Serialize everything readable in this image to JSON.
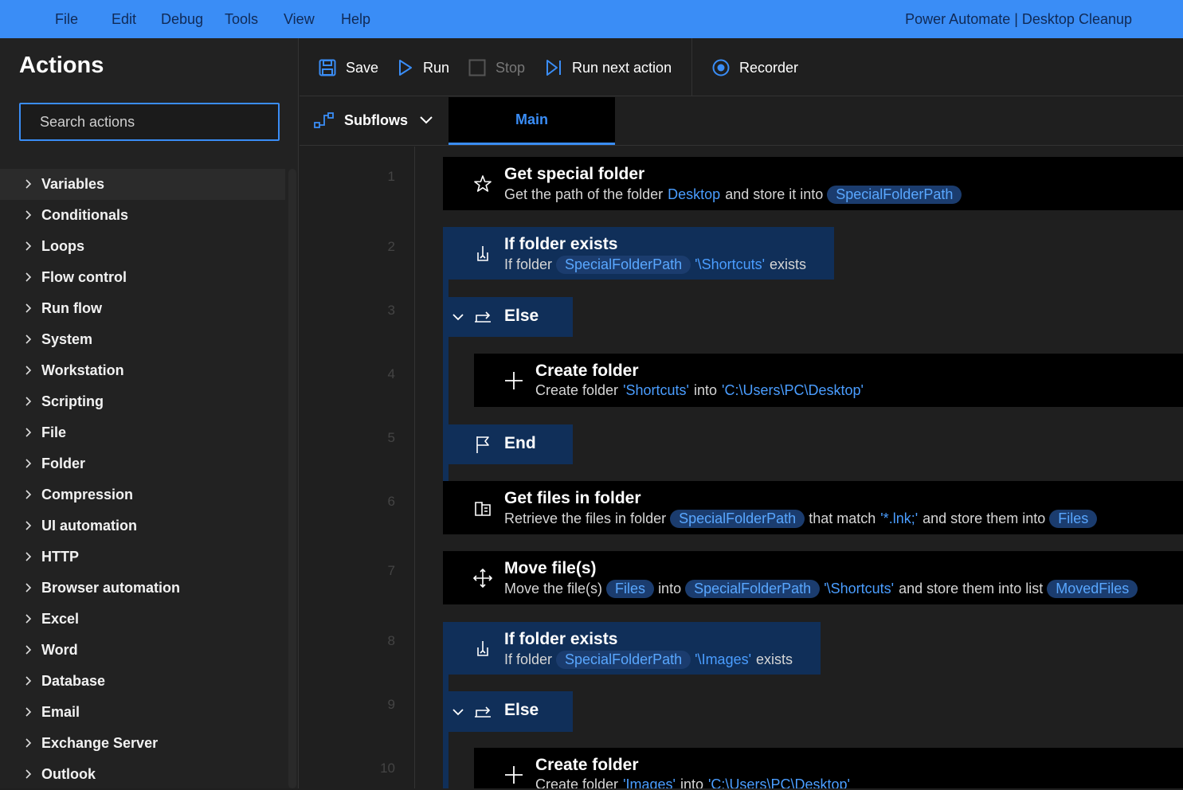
{
  "menu": {
    "items": [
      "File",
      "Edit",
      "Debug",
      "Tools",
      "View",
      "Help"
    ],
    "app_title": "Power Automate | Desktop Cleanup"
  },
  "actions_pane": {
    "title": "Actions",
    "search_placeholder": "Search actions",
    "categories": [
      "Variables",
      "Conditionals",
      "Loops",
      "Flow control",
      "Run flow",
      "System",
      "Workstation",
      "Scripting",
      "File",
      "Folder",
      "Compression",
      "UI automation",
      "HTTP",
      "Browser automation",
      "Excel",
      "Word",
      "Database",
      "Email",
      "Exchange Server",
      "Outlook"
    ]
  },
  "toolbar": {
    "save": "Save",
    "run": "Run",
    "stop": "Stop",
    "run_next": "Run next action",
    "recorder": "Recorder"
  },
  "tabs": {
    "subflows": "Subflows",
    "main": "Main"
  },
  "flow": {
    "line_numbers": [
      "1",
      "2",
      "3",
      "4",
      "5",
      "6",
      "7",
      "8",
      "9",
      "10"
    ],
    "steps": [
      {
        "title": "Get special folder",
        "icon": "star-icon",
        "desc": [
          {
            "k": "t",
            "v": "Get the path of the folder"
          },
          {
            "k": "lit",
            "v": "Desktop"
          },
          {
            "k": "t",
            "v": "and store it into"
          },
          {
            "k": "var",
            "v": "SpecialFolderPath"
          }
        ]
      },
      {
        "title": "If folder exists",
        "icon": "branch-icon",
        "desc": [
          {
            "k": "t",
            "v": "If folder"
          },
          {
            "k": "var",
            "v": "SpecialFolderPath"
          },
          {
            "k": "lit",
            "v": "'\\Shortcuts'"
          },
          {
            "k": "t",
            "v": "exists"
          }
        ]
      },
      {
        "title": "Else",
        "icon": "else-icon",
        "desc": []
      },
      {
        "title": "Create folder",
        "icon": "plus-icon",
        "desc": [
          {
            "k": "t",
            "v": "Create folder"
          },
          {
            "k": "lit",
            "v": "'Shortcuts'"
          },
          {
            "k": "t",
            "v": "into"
          },
          {
            "k": "lit",
            "v": "'C:\\Users\\PC\\Desktop'"
          }
        ]
      },
      {
        "title": "End",
        "icon": "flag-icon",
        "desc": []
      },
      {
        "title": "Get files in folder",
        "icon": "files-icon",
        "desc": [
          {
            "k": "t",
            "v": "Retrieve the files in folder"
          },
          {
            "k": "var",
            "v": "SpecialFolderPath"
          },
          {
            "k": "t",
            "v": "that match"
          },
          {
            "k": "lit",
            "v": "'*.lnk;'"
          },
          {
            "k": "t",
            "v": "and store them into"
          },
          {
            "k": "var",
            "v": "Files"
          }
        ]
      },
      {
        "title": "Move file(s)",
        "icon": "move-icon",
        "desc": [
          {
            "k": "t",
            "v": "Move the file(s)"
          },
          {
            "k": "var",
            "v": "Files"
          },
          {
            "k": "t",
            "v": "into"
          },
          {
            "k": "var",
            "v": "SpecialFolderPath"
          },
          {
            "k": "lit",
            "v": "'\\Shortcuts'"
          },
          {
            "k": "t",
            "v": "and store them into list"
          },
          {
            "k": "var",
            "v": "MovedFiles"
          }
        ]
      },
      {
        "title": "If folder exists",
        "icon": "branch-icon",
        "desc": [
          {
            "k": "t",
            "v": "If folder"
          },
          {
            "k": "var",
            "v": "SpecialFolderPath"
          },
          {
            "k": "lit",
            "v": "'\\Images'"
          },
          {
            "k": "t",
            "v": "exists"
          }
        ]
      },
      {
        "title": "Else",
        "icon": "else-icon",
        "desc": []
      },
      {
        "title": "Create folder",
        "icon": "plus-icon",
        "desc": [
          {
            "k": "t",
            "v": "Create folder"
          },
          {
            "k": "lit",
            "v": "'Images'"
          },
          {
            "k": "t",
            "v": "into"
          },
          {
            "k": "lit",
            "v": "'C:\\Users\\PC\\Desktop'"
          }
        ]
      }
    ]
  },
  "colors": {
    "accent": "#3a8df6",
    "block_black": "#000000",
    "block_blue": "#102f59",
    "variable_pill": "#1b3c6e",
    "literal_text": "#4a9dff"
  }
}
